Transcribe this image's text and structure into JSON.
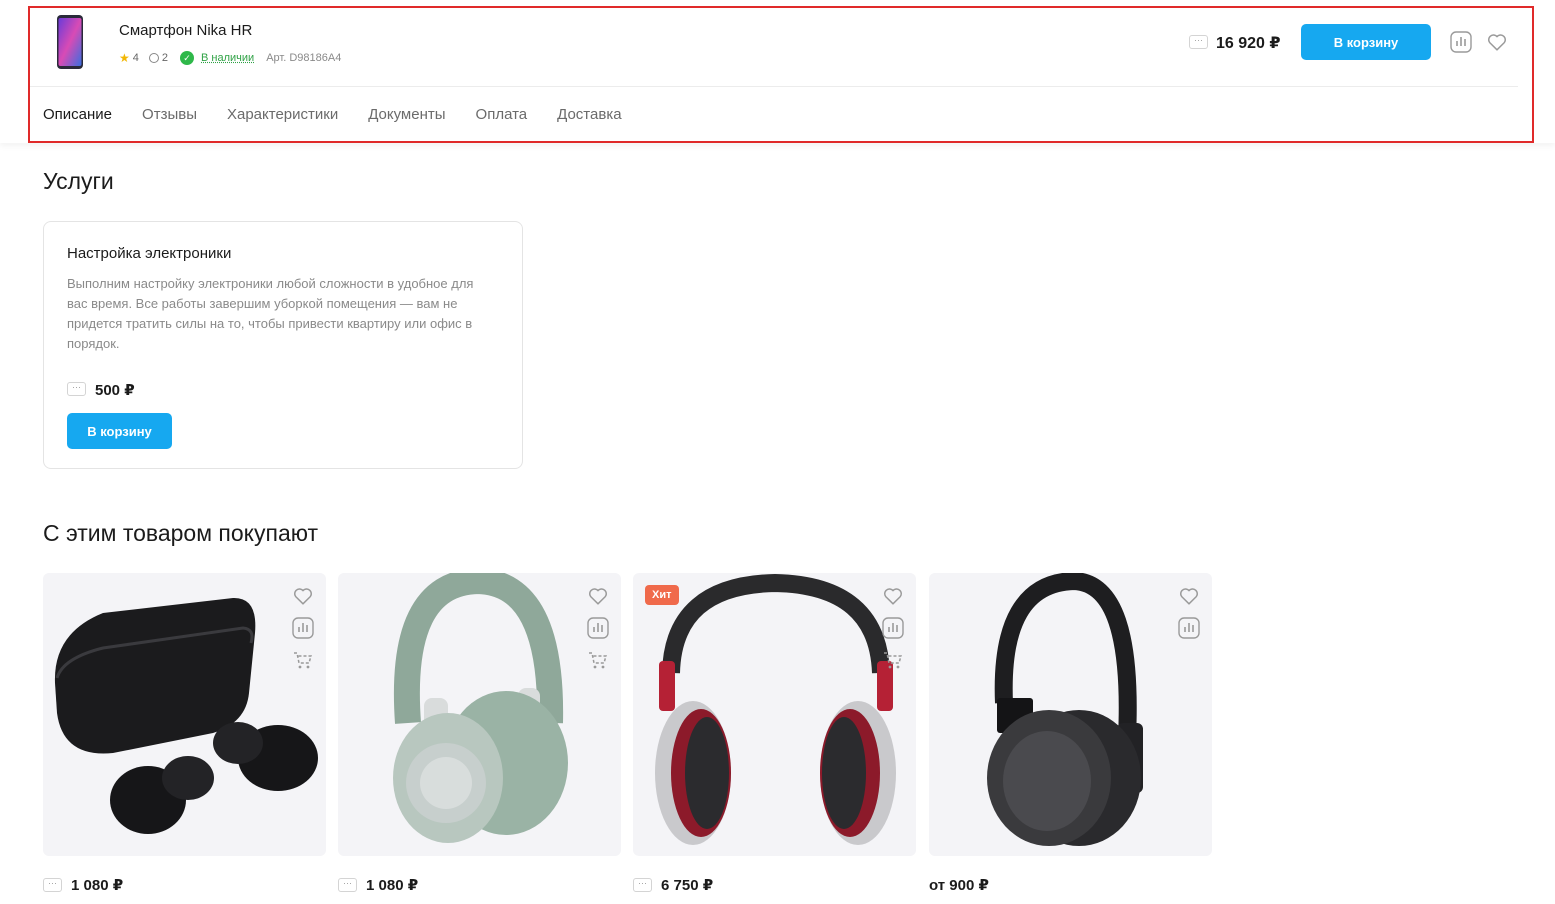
{
  "header": {
    "product_title": "Смартфон Nika HR",
    "rating": "4",
    "reviews_count": "2",
    "stock": "В наличии",
    "article": "Арт. D98186A4",
    "price": "16 920 ₽",
    "cart_label": "В корзину"
  },
  "tabs": [
    {
      "label": "Описание",
      "active": true
    },
    {
      "label": "Отзывы",
      "active": false
    },
    {
      "label": "Характеристики",
      "active": false
    },
    {
      "label": "Документы",
      "active": false
    },
    {
      "label": "Оплата",
      "active": false
    },
    {
      "label": "Доставка",
      "active": false
    }
  ],
  "services": {
    "heading": "Услуги",
    "card": {
      "title": "Настройка электроники",
      "description": "Выполним настройку электроники любой сложности в удобное для вас время. Все работы завершим уборкой помещения — вам не придется тратить силы на то, чтобы привести квартиру или офис в порядок.",
      "price": "500 ₽",
      "cart_label": "В корзину"
    }
  },
  "related": {
    "heading": "С этим товаром покупают",
    "products": [
      {
        "price": "1 080 ₽",
        "badge": ""
      },
      {
        "price": "1 080 ₽",
        "badge": ""
      },
      {
        "price": "6 750 ₽",
        "badge": "Хит"
      },
      {
        "price": "от 900 ₽",
        "badge": ""
      }
    ]
  },
  "colors": {
    "accent": "#16a8f0",
    "highlight": "#e02a2a",
    "stock": "#2fa245",
    "hit_badge": "#f06a4b"
  }
}
